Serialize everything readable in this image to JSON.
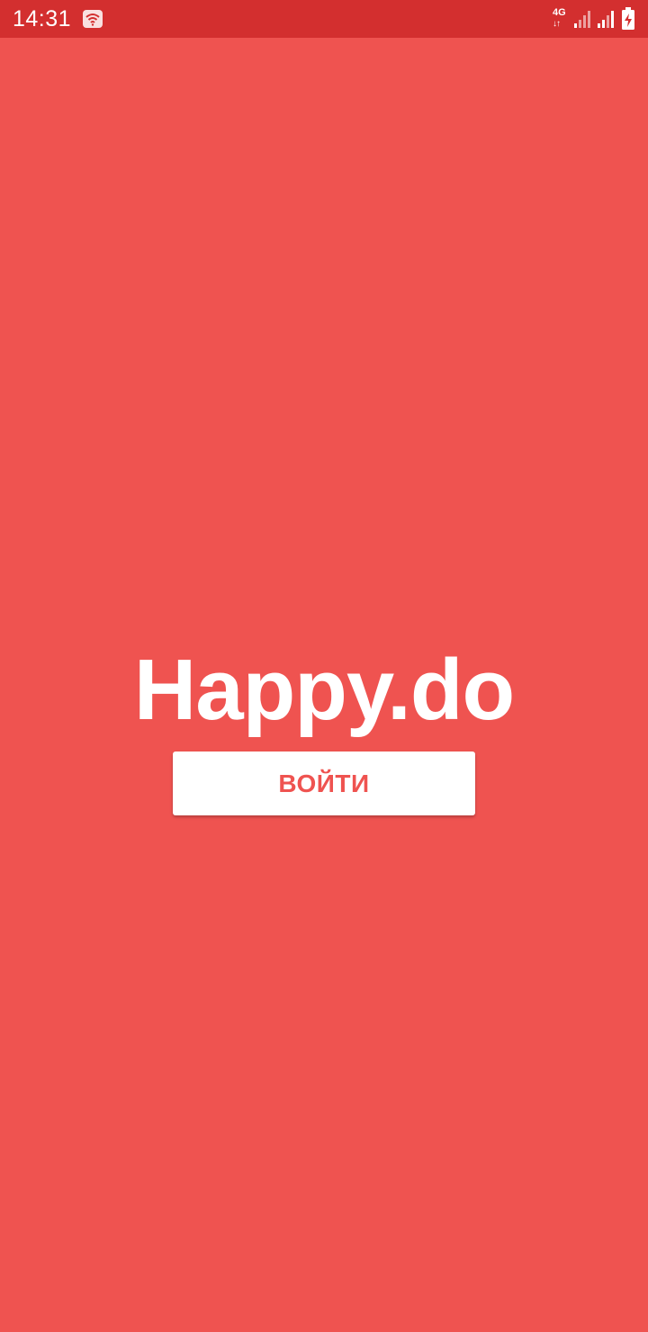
{
  "status_bar": {
    "time": "14:31",
    "network_type": "4G",
    "network_arrows": "↓↑",
    "battery_level_fraction": 0.8,
    "color": "#D32F2F"
  },
  "app": {
    "title": "Happy.do",
    "login_label": "ВОЙТИ",
    "background_color": "#EF5350",
    "button_color": "#FFFFFF"
  },
  "icons": {
    "wifi": "wifi-icon",
    "signal": "signal-icon",
    "battery": "battery-charging-icon"
  }
}
